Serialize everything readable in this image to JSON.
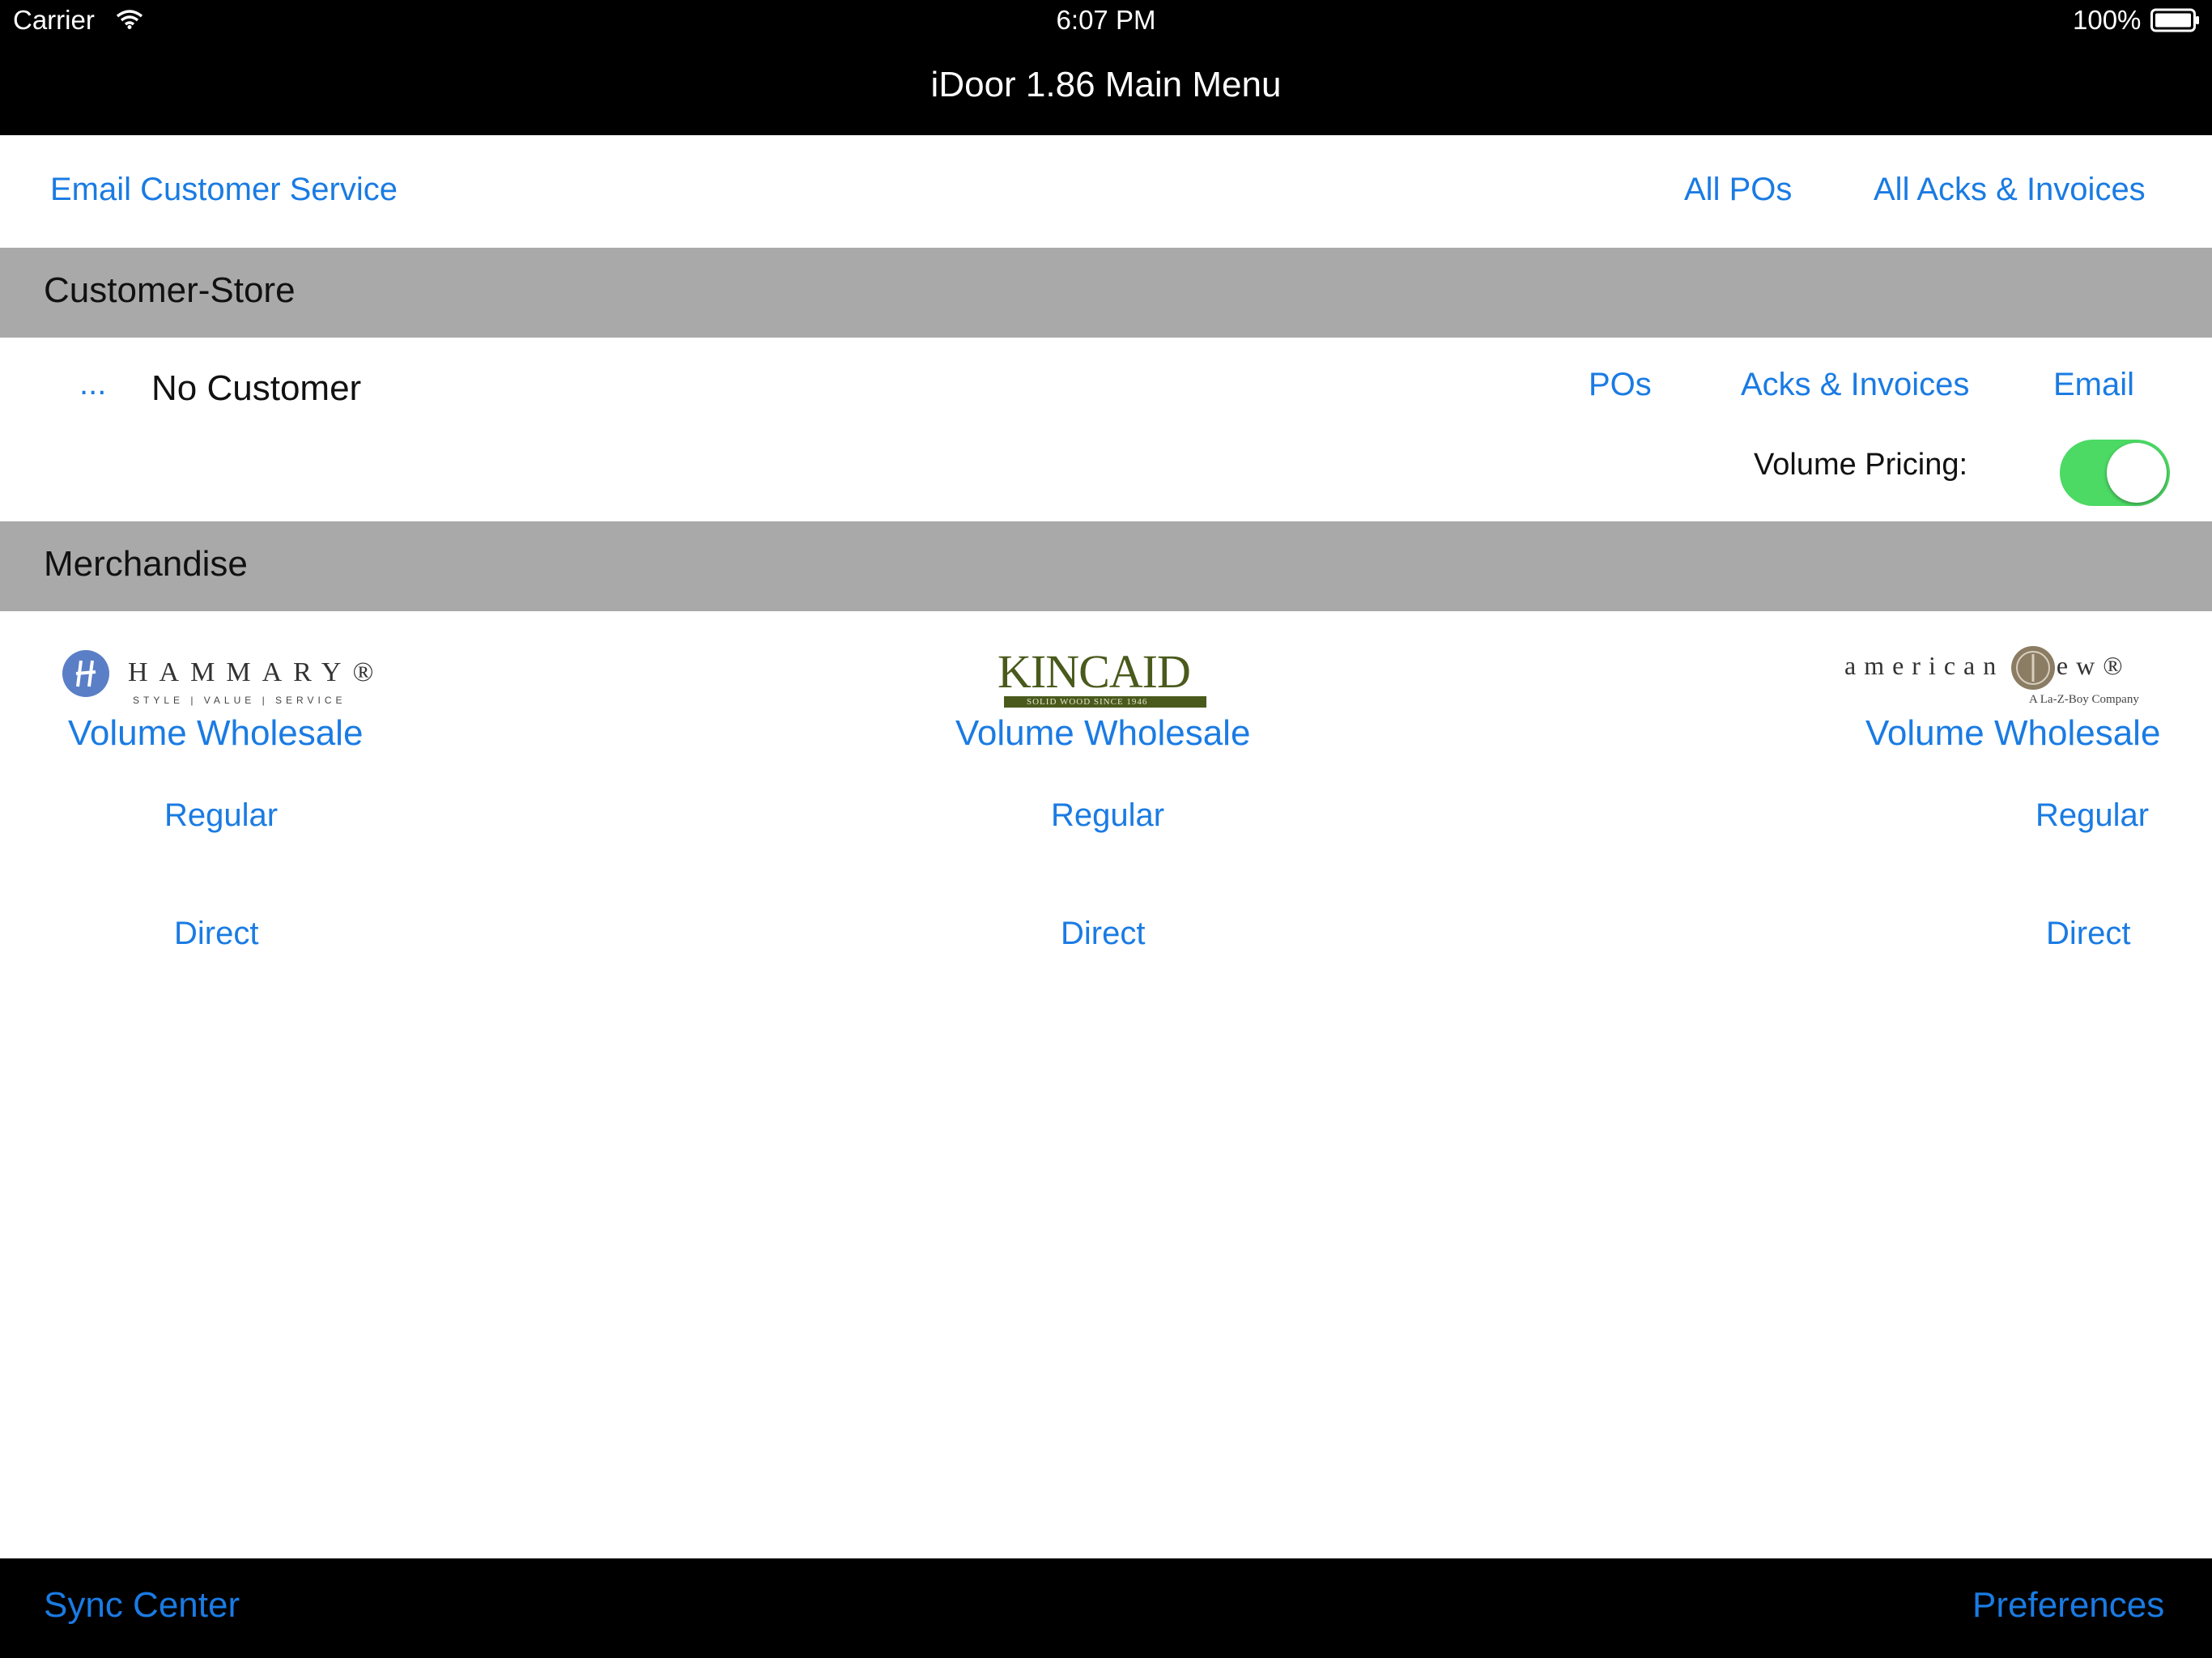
{
  "status_bar": {
    "carrier": "Carrier",
    "time": "6:07 PM",
    "battery": "100%"
  },
  "nav": {
    "title": "iDoor 1.86 Main Menu"
  },
  "toolbar": {
    "email_customer_service": "Email Customer Service",
    "all_pos": "All POs",
    "all_acks_invoices": "All Acks & Invoices"
  },
  "sections": {
    "customer_store": "Customer-Store",
    "merchandise": "Merchandise"
  },
  "customer": {
    "more": "...",
    "name": "No Customer",
    "pos": "POs",
    "acks_invoices": "Acks & Invoices",
    "email": "Email",
    "volume_pricing_label": "Volume Pricing:",
    "volume_pricing_on": true
  },
  "brands": [
    {
      "logo_text": "HAMMARY®",
      "logo_tagline": "STYLE | VALUE | SERVICE",
      "volume_wholesale": "Volume Wholesale",
      "regular": "Regular",
      "direct": "Direct"
    },
    {
      "logo_text": "KINCAID",
      "logo_tagline": "SOLID WOOD SINCE 1946",
      "volume_wholesale": "Volume Wholesale",
      "regular": "Regular",
      "direct": "Direct"
    },
    {
      "logo_text": "american drew®",
      "logo_tagline": "A La-Z-Boy Company",
      "volume_wholesale": "Volume Wholesale",
      "regular": "Regular",
      "direct": "Direct"
    }
  ],
  "bottom_bar": {
    "sync_center": "Sync Center",
    "preferences": "Preferences"
  },
  "colors": {
    "accent": "#1a7be3",
    "section_bg": "#a9a9a9",
    "toggle_on": "#4cd964",
    "bar_bg": "#000000"
  },
  "icons": [
    "wifi-icon",
    "battery-icon",
    "hammary-logo",
    "kincaid-logo",
    "american-drew-logo",
    "toggle-switch"
  ]
}
